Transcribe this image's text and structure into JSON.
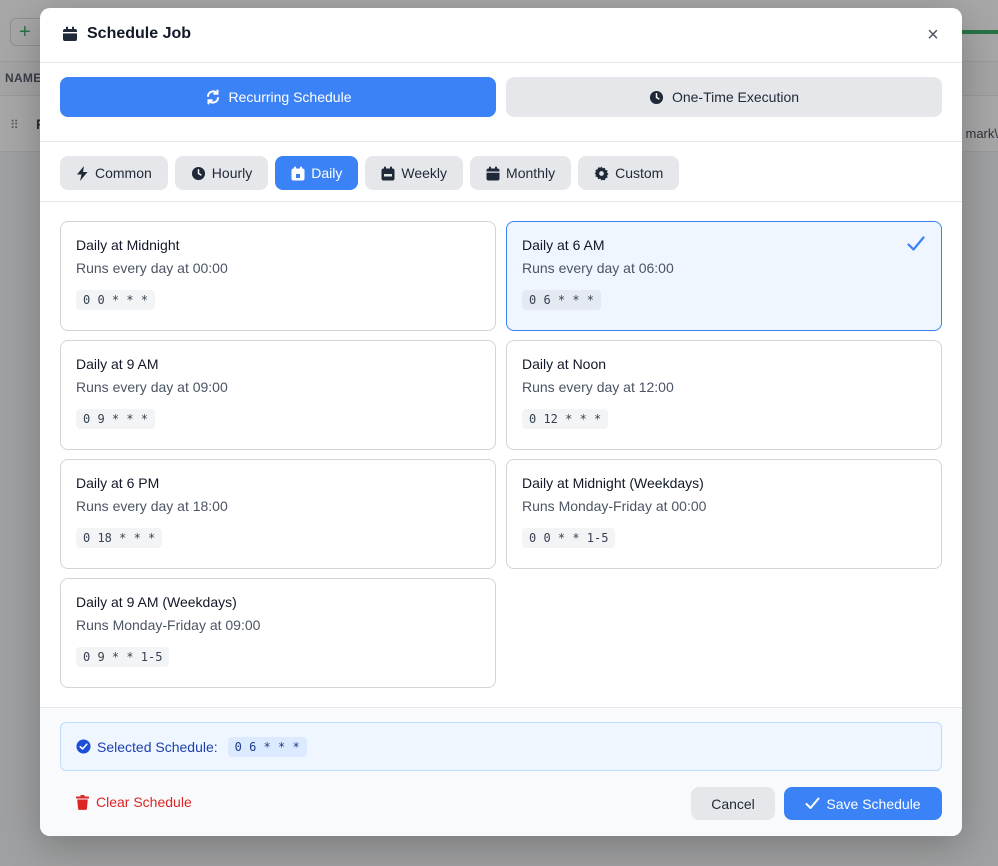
{
  "background": {
    "add_label": "+",
    "column_header": "NAME",
    "row_text": "P",
    "row_right": "mark\\"
  },
  "modal": {
    "title": "Schedule Job",
    "close_label": "×",
    "title_icon": "calendar-icon"
  },
  "modes": [
    {
      "label": "Recurring Schedule",
      "icon": "repeat-icon",
      "active": true
    },
    {
      "label": "One-Time Execution",
      "icon": "clock-icon",
      "active": false
    }
  ],
  "tabs": [
    {
      "label": "Common",
      "icon": "bolt-icon"
    },
    {
      "label": "Hourly",
      "icon": "clock-icon"
    },
    {
      "label": "Daily",
      "icon": "calendar-day-icon",
      "active": true
    },
    {
      "label": "Weekly",
      "icon": "calendar-week-icon"
    },
    {
      "label": "Monthly",
      "icon": "calendar-icon"
    },
    {
      "label": "Custom",
      "icon": "gear-icon"
    }
  ],
  "presets": [
    {
      "title": "Daily at Midnight",
      "desc": "Runs every day at 00:00",
      "cron": "0 0 * * *"
    },
    {
      "title": "Daily at 6 AM",
      "desc": "Runs every day at 06:00",
      "cron": "0 6 * * *",
      "selected": true
    },
    {
      "title": "Daily at 9 AM",
      "desc": "Runs every day at 09:00",
      "cron": "0 9 * * *"
    },
    {
      "title": "Daily at Noon",
      "desc": "Runs every day at 12:00",
      "cron": "0 12 * * *"
    },
    {
      "title": "Daily at 6 PM",
      "desc": "Runs every day at 18:00",
      "cron": "0 18 * * *"
    },
    {
      "title": "Daily at Midnight (Weekdays)",
      "desc": "Runs Monday-Friday at 00:00",
      "cron": "0 0 * * 1-5"
    },
    {
      "title": "Daily at 9 AM (Weekdays)",
      "desc": "Runs Monday-Friday at 09:00",
      "cron": "0 9 * * 1-5"
    }
  ],
  "footer": {
    "selected_label": "Selected Schedule:",
    "selected_cron": "0 6 * * *",
    "clear_label": "Clear Schedule",
    "cancel_label": "Cancel",
    "save_label": "Save Schedule"
  },
  "colors": {
    "accent": "#3b82f6",
    "danger": "#dc2626",
    "selected_bg": "#eff6ff"
  }
}
